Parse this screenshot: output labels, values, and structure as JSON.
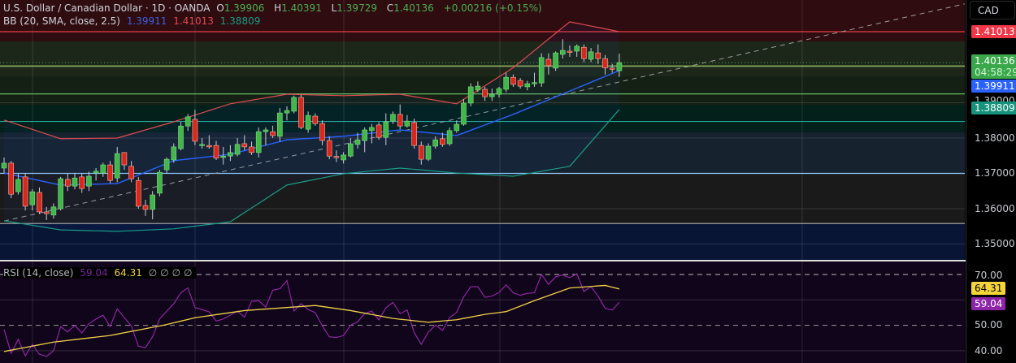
{
  "header": {
    "symbol": "U.S. Dollar / Canadian Dollar · 1D · OANDA",
    "open_label": "O",
    "open": "1.39906",
    "high_label": "H",
    "high": "1.40391",
    "low_label": "L",
    "low": "1.39729",
    "close_label": "C",
    "close": "1.40136",
    "change": "+0.00216 (+0.15%)"
  },
  "bb": {
    "label": "BB (20, SMA, close, 2.5)",
    "basis": "1.39911",
    "upper": "1.41013",
    "lower": "1.38809"
  },
  "rsi_header": {
    "label": "RSI (14, close)",
    "rsi": "59.04",
    "ma": "64.31",
    "empty": [
      "∅",
      "∅",
      "∅",
      "∅"
    ]
  },
  "scale": {
    "currency": "CAD",
    "price_ticks": [
      "1.39000",
      "1.38000",
      "1.37000",
      "1.36000",
      "1.35000"
    ],
    "upper_label": "1.41013",
    "last_price": "1.40136",
    "countdown": "04:58:29",
    "basis_label": "1.39911",
    "lower_label": "1.38809",
    "rsi_ticks": [
      "70.00",
      "50.00",
      "40.00"
    ],
    "rsi_ma_label": "64.31",
    "rsi_label": "59.04"
  },
  "colors": {
    "up": "#43b54a",
    "down": "#d8281d",
    "basis": "#2962ff",
    "upper": "#e04a52",
    "lower": "#1a9c86",
    "rsi": "#9c27b0",
    "rsi_ma": "#f0d04a"
  },
  "chart_data": {
    "type": "candlestick",
    "price_range": [
      1.345,
      1.4175
    ],
    "candles": [
      [
        1.3715,
        1.3745,
        1.37,
        1.3729
      ],
      [
        1.3729,
        1.3735,
        1.363,
        1.3641
      ],
      [
        1.3648,
        1.37,
        1.364,
        1.3683
      ],
      [
        1.369,
        1.37,
        1.3595,
        1.3607
      ],
      [
        1.3611,
        1.3655,
        1.3595,
        1.3648
      ],
      [
        1.3646,
        1.366,
        1.3585,
        1.3591
      ],
      [
        1.3591,
        1.3605,
        1.3568,
        1.3586
      ],
      [
        1.3582,
        1.3615,
        1.3572,
        1.3605
      ],
      [
        1.36,
        1.369,
        1.3595,
        1.3685
      ],
      [
        1.3683,
        1.37,
        1.365,
        1.3664
      ],
      [
        1.3664,
        1.37,
        1.3655,
        1.3687
      ],
      [
        1.369,
        1.37,
        1.3645,
        1.3657
      ],
      [
        1.3664,
        1.3705,
        1.365,
        1.3692
      ],
      [
        1.3701,
        1.3715,
        1.368,
        1.3706
      ],
      [
        1.3701,
        1.373,
        1.369,
        1.3724
      ],
      [
        1.3724,
        1.3735,
        1.3672,
        1.368
      ],
      [
        1.3687,
        1.3775,
        1.3675,
        1.3756
      ],
      [
        1.3759,
        1.376,
        1.371,
        1.3724
      ],
      [
        1.372,
        1.3735,
        1.3675,
        1.3685
      ],
      [
        1.368,
        1.369,
        1.36,
        1.3607
      ],
      [
        1.3609,
        1.3625,
        1.358,
        1.3598
      ],
      [
        1.3598,
        1.365,
        1.357,
        1.3639
      ],
      [
        1.3644,
        1.371,
        1.3635,
        1.3703
      ],
      [
        1.371,
        1.3745,
        1.37,
        1.374
      ],
      [
        1.3738,
        1.3785,
        1.373,
        1.3775
      ],
      [
        1.377,
        1.3845,
        1.3765,
        1.3834
      ],
      [
        1.3834,
        1.3868,
        1.382,
        1.386
      ],
      [
        1.3853,
        1.388,
        1.378,
        1.3791
      ],
      [
        1.3779,
        1.38,
        1.377,
        1.3782
      ],
      [
        1.3779,
        1.3808,
        1.377,
        1.3775
      ],
      [
        1.3779,
        1.3792,
        1.3738,
        1.3743
      ],
      [
        1.3745,
        1.3775,
        1.3725,
        1.3749
      ],
      [
        1.3749,
        1.378,
        1.3735,
        1.3759
      ],
      [
        1.3754,
        1.38,
        1.3748,
        1.3782
      ],
      [
        1.3784,
        1.3808,
        1.3765,
        1.3775
      ],
      [
        1.3775,
        1.379,
        1.3752,
        1.3759
      ],
      [
        1.3759,
        1.383,
        1.3745,
        1.3818
      ],
      [
        1.3818,
        1.383,
        1.378,
        1.3823
      ],
      [
        1.3818,
        1.3835,
        1.38,
        1.3807
      ],
      [
        1.3805,
        1.3885,
        1.379,
        1.3871
      ],
      [
        1.3871,
        1.389,
        1.385,
        1.3878
      ],
      [
        1.3876,
        1.392,
        1.387,
        1.3915
      ],
      [
        1.3915,
        1.3922,
        1.3825,
        1.383
      ],
      [
        1.3825,
        1.3875,
        1.3815,
        1.3864
      ],
      [
        1.3862,
        1.387,
        1.3835,
        1.3841
      ],
      [
        1.3841,
        1.385,
        1.378,
        1.3793
      ],
      [
        1.3793,
        1.3805,
        1.374,
        1.3749
      ],
      [
        1.3748,
        1.3765,
        1.3732,
        1.3746
      ],
      [
        1.3738,
        1.376,
        1.3728,
        1.3752
      ],
      [
        1.3749,
        1.38,
        1.3745,
        1.3784
      ],
      [
        1.3782,
        1.3815,
        1.377,
        1.3795
      ],
      [
        1.3793,
        1.383,
        1.376,
        1.3823
      ],
      [
        1.3821,
        1.384,
        1.3785,
        1.383
      ],
      [
        1.3837,
        1.3845,
        1.3795,
        1.3802
      ],
      [
        1.3802,
        1.387,
        1.378,
        1.3846
      ],
      [
        1.3848,
        1.3875,
        1.384,
        1.3867
      ],
      [
        1.3867,
        1.3895,
        1.3825,
        1.3834
      ],
      [
        1.3834,
        1.3865,
        1.383,
        1.3848
      ],
      [
        1.3844,
        1.3855,
        1.377,
        1.3779
      ],
      [
        1.3779,
        1.379,
        1.3725,
        1.374
      ],
      [
        1.374,
        1.3785,
        1.3735,
        1.3777
      ],
      [
        1.3777,
        1.3805,
        1.377,
        1.3795
      ],
      [
        1.3798,
        1.3815,
        1.3775,
        1.3782
      ],
      [
        1.3784,
        1.383,
        1.3778,
        1.3821
      ],
      [
        1.3821,
        1.385,
        1.3815,
        1.3839
      ],
      [
        1.3839,
        1.391,
        1.3835,
        1.3899
      ],
      [
        1.3899,
        1.3955,
        1.389,
        1.3945
      ],
      [
        1.3936,
        1.396,
        1.393,
        1.3947
      ],
      [
        1.3938,
        1.3945,
        1.3905,
        1.3917
      ],
      [
        1.3917,
        1.394,
        1.3905,
        1.3924
      ],
      [
        1.3924,
        1.3945,
        1.3915,
        1.394
      ],
      [
        1.3938,
        1.3985,
        1.393,
        1.3972
      ],
      [
        1.3972,
        1.398,
        1.3945,
        1.3952
      ],
      [
        1.3963,
        1.397,
        1.394,
        1.3947
      ],
      [
        1.3945,
        1.3962,
        1.3935,
        1.3954
      ],
      [
        1.3956,
        1.3985,
        1.3945,
        1.3957
      ],
      [
        1.3956,
        1.404,
        1.3945,
        1.4028
      ],
      [
        1.4023,
        1.404,
        1.398,
        1.4005
      ],
      [
        1.3998,
        1.4045,
        1.399,
        1.4041
      ],
      [
        1.4037,
        1.408,
        1.4025,
        1.4048
      ],
      [
        1.4046,
        1.4062,
        1.403,
        1.4044
      ],
      [
        1.4046,
        1.4065,
        1.403,
        1.406
      ],
      [
        1.4057,
        1.4065,
        1.4015,
        1.4025
      ],
      [
        1.4023,
        1.4055,
        1.4015,
        1.4044
      ],
      [
        1.4041,
        1.4065,
        1.401,
        1.4025
      ],
      [
        1.4025,
        1.4035,
        1.398,
        1.3999
      ],
      [
        1.3998,
        1.401,
        1.3985,
        1.3997
      ],
      [
        1.39906,
        1.40391,
        1.39729,
        1.40136
      ]
    ],
    "bb_upper": [
      [
        0,
        1.3851
      ],
      [
        8,
        1.3798
      ],
      [
        16,
        1.38
      ],
      [
        24,
        1.3846
      ],
      [
        32,
        1.3897
      ],
      [
        40,
        1.3924
      ],
      [
        48,
        1.392
      ],
      [
        56,
        1.3924
      ],
      [
        64,
        1.3897
      ],
      [
        72,
        1.3999
      ],
      [
        80,
        1.4129
      ],
      [
        87,
        1.41013
      ]
    ],
    "bb_basis": [
      [
        0,
        1.3701
      ],
      [
        8,
        1.3667
      ],
      [
        16,
        1.3671
      ],
      [
        24,
        1.3736
      ],
      [
        32,
        1.3754
      ],
      [
        40,
        1.3795
      ],
      [
        48,
        1.3805
      ],
      [
        56,
        1.3823
      ],
      [
        64,
        1.3807
      ],
      [
        72,
        1.3867
      ],
      [
        80,
        1.3933
      ],
      [
        87,
        1.39911
      ]
    ],
    "bb_lower": [
      [
        0,
        1.3566
      ],
      [
        8,
        1.354
      ],
      [
        16,
        1.3536
      ],
      [
        24,
        1.3543
      ],
      [
        32,
        1.3563
      ],
      [
        40,
        1.3667
      ],
      [
        48,
        1.3699
      ],
      [
        56,
        1.3715
      ],
      [
        64,
        1.3701
      ],
      [
        72,
        1.3692
      ],
      [
        80,
        1.372
      ],
      [
        87,
        1.38809
      ]
    ],
    "horizontal_levels": [
      1.41013,
      1.4004,
      1.3925,
      1.3847,
      1.37,
      1.3558
    ],
    "trendline": [
      [
        0,
        1.3565
      ],
      [
        137,
        1.4185
      ]
    ],
    "rsi_range": [
      35,
      72
    ],
    "rsi": [
      48.4,
      39,
      44.5,
      38,
      42.5,
      38.6,
      37.8,
      40,
      49.5,
      47.4,
      50,
      47,
      50.6,
      52.5,
      54,
      49.5,
      56.5,
      53,
      49.8,
      41.8,
      41.2,
      45.5,
      52.5,
      55.6,
      58.5,
      62.8,
      64.7,
      57,
      56.2,
      55.3,
      51.7,
      52.5,
      54,
      55.6,
      53.2,
      59.4,
      59.7,
      57.2,
      63.8,
      64.4,
      67.6,
      55.6,
      58.5,
      56.2,
      55,
      49.8,
      45.5,
      45.2,
      46,
      50,
      51.4,
      54.6,
      55.6,
      52.1,
      56.9,
      59,
      54.6,
      56,
      47.1,
      42.5,
      47.3,
      50.1,
      48,
      53,
      55.1,
      61.2,
      65.2,
      65.2,
      61,
      61.5,
      62.9,
      66,
      62.8,
      61.8,
      62.6,
      62.8,
      70,
      66.1,
      69.1,
      69.8,
      68.7,
      70.3,
      63.3,
      65.2,
      61.5,
      56.7,
      56,
      59.04
    ],
    "rsi_ma": [
      [
        0,
        39.7
      ],
      [
        7,
        43.4
      ],
      [
        15,
        46
      ],
      [
        23,
        50.3
      ],
      [
        27,
        53
      ],
      [
        34,
        55.8
      ],
      [
        42,
        57.4
      ],
      [
        44,
        57.8
      ],
      [
        49,
        55.8
      ],
      [
        55,
        52.7
      ],
      [
        60,
        51.2
      ],
      [
        64,
        52.2
      ],
      [
        68,
        54.3
      ],
      [
        71,
        55.4
      ],
      [
        75,
        59.7
      ],
      [
        80,
        64.7
      ],
      [
        85,
        65.7
      ],
      [
        87,
        64.31
      ]
    ]
  }
}
